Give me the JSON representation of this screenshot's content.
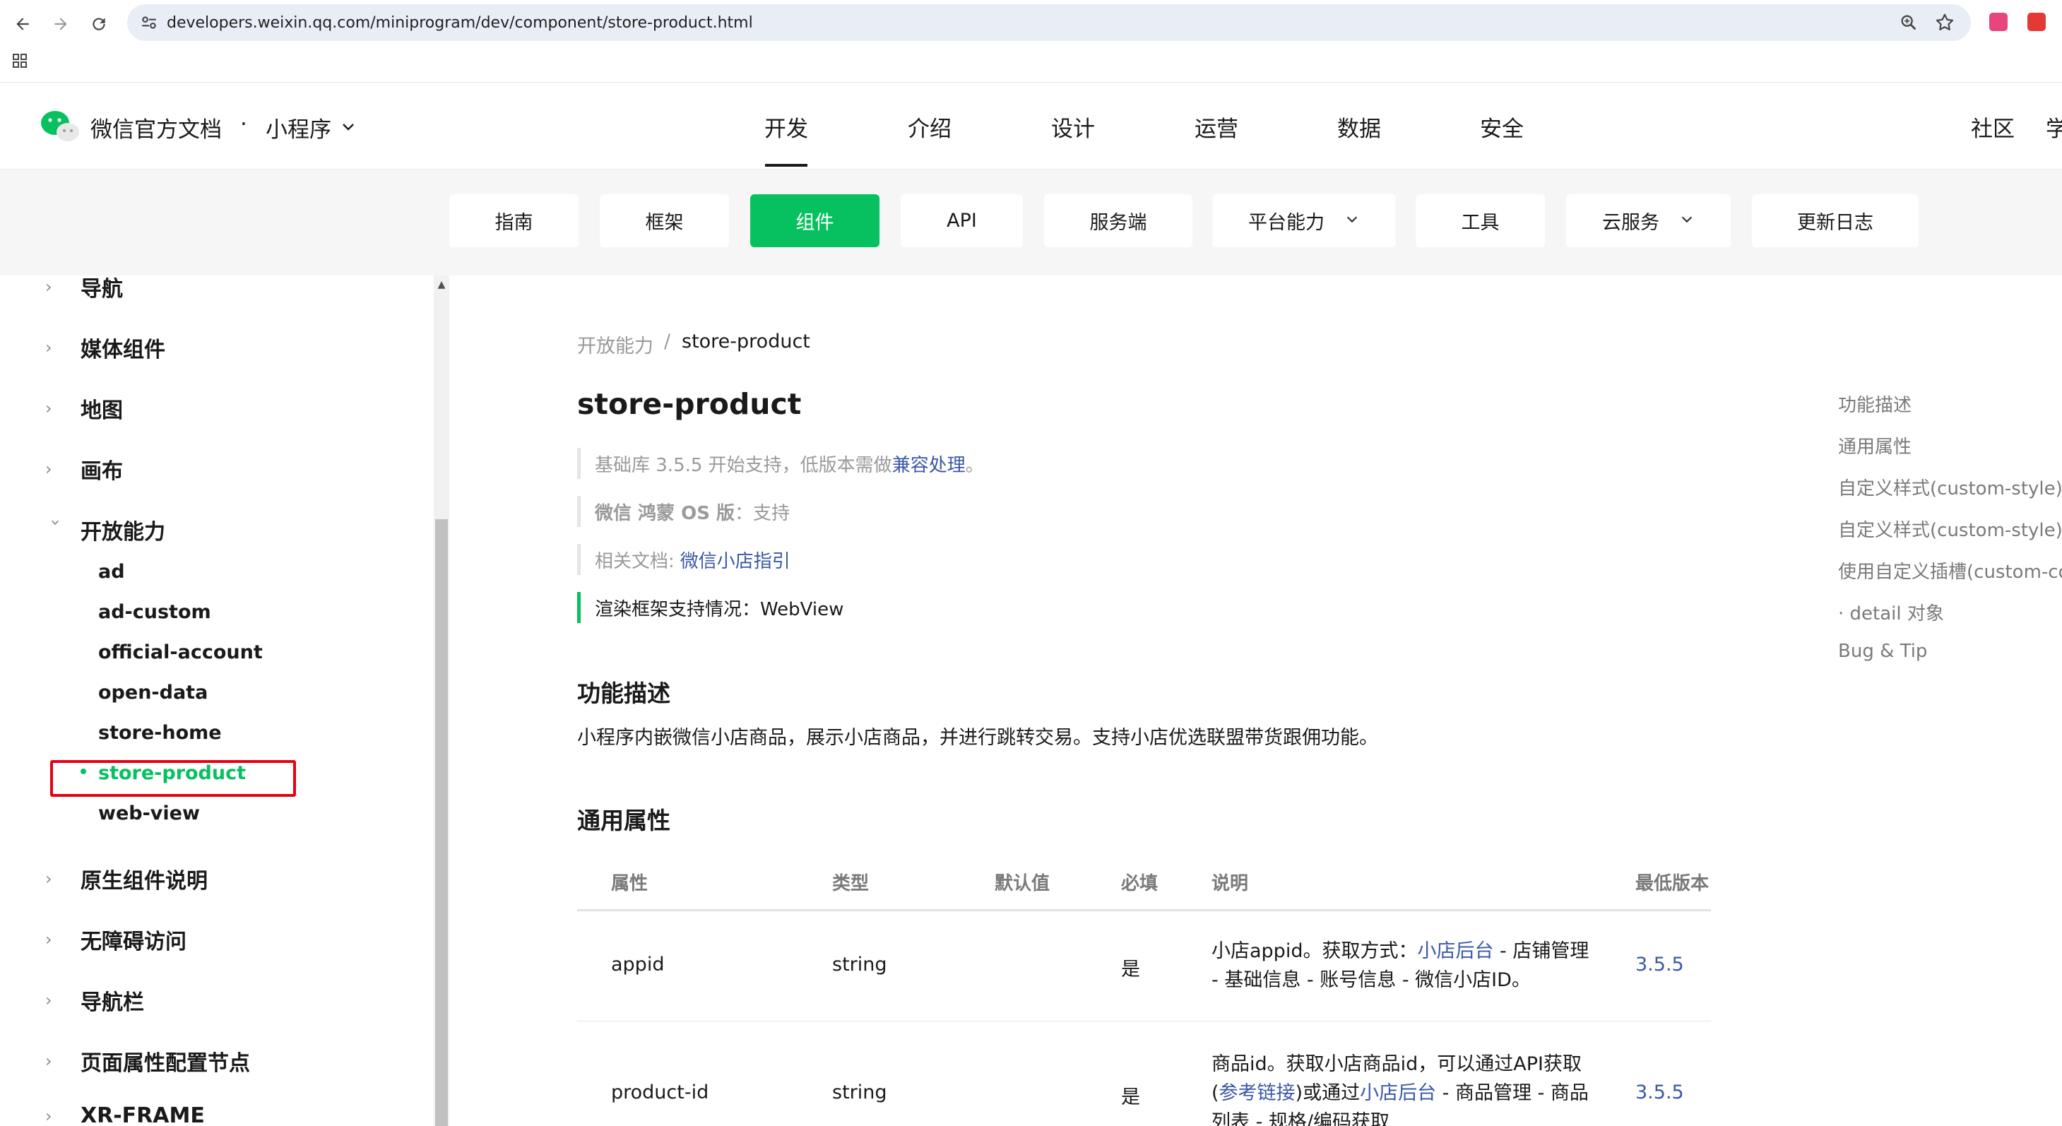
{
  "browser": {
    "url": "developers.weixin.qq.com/miniprogram/dev/component/store-product.html",
    "icons": [
      "back-icon",
      "forward-icon",
      "reload-icon",
      "site-settings-icon",
      "zoom-icon",
      "star-icon",
      "apps-icon"
    ]
  },
  "header": {
    "brand": "微信官方文档",
    "dot": "·",
    "product": "小程序",
    "nav": [
      "开发",
      "介绍",
      "设计",
      "运营",
      "数据",
      "安全"
    ],
    "community": "社区",
    "extra": "学"
  },
  "subtabs": [
    {
      "label": "指南"
    },
    {
      "label": "框架"
    },
    {
      "label": "组件"
    },
    {
      "label": "API"
    },
    {
      "label": "服务端"
    },
    {
      "label": "平台能力"
    },
    {
      "label": "工具"
    },
    {
      "label": "云服务"
    },
    {
      "label": "更新日志"
    }
  ],
  "sidebar": {
    "groups_top": [
      "导航",
      "媒体组件",
      "地图",
      "画布",
      "开放能力"
    ],
    "open_items": [
      "ad",
      "ad-custom",
      "official-account",
      "open-data",
      "store-home",
      "store-product",
      "web-view"
    ],
    "groups_bottom": [
      "原生组件说明",
      "无障碍访问",
      "导航栏",
      "页面属性配置节点",
      "XR-FRAME"
    ]
  },
  "breadcrumb": {
    "parent": "开放能力",
    "sep": "/",
    "current": "store-product"
  },
  "content": {
    "title": "store-product",
    "notes": {
      "base_prefix": "基础库 3.5.5 开始支持，低版本需做",
      "base_link": "兼容处理",
      "base_suffix": "。",
      "harmony_bold": "微信 鸿蒙 OS 版",
      "harmony_rest": "：支持",
      "docs_prefix": "相关文档: ",
      "docs_link": "微信小店指引",
      "render": "渲染框架支持情况：WebView"
    },
    "section1_title": "功能描述",
    "section1_text": "小程序内嵌微信小店商品，展示小店商品，并进行跳转交易。支持小店优选联盟带货跟佣功能。",
    "section2_title": "通用属性",
    "table": {
      "headers": [
        "属性",
        "类型",
        "默认值",
        "必填",
        "说明",
        "最低版本"
      ],
      "rows": [
        {
          "name": "appid",
          "type": "string",
          "required": "是",
          "desc_pre": "小店appid。获取方式：",
          "desc_link": "小店后台",
          "desc_post": " - 店铺管理 - 基础信息 - 账号信息 - 微信小店ID。",
          "version": "3.5.5"
        },
        {
          "name": "product-id",
          "type": "string",
          "required": "是",
          "desc_pre": "商品id。获取小店商品id，可以通过API获取(",
          "desc_link": "参考链接",
          "desc_mid": ")或通过",
          "desc_link2": "小店后台",
          "desc_post": " - 商品管理 - 商品列表 - 规格/编码获取",
          "version": "3.5.5"
        }
      ]
    }
  },
  "toc": [
    "功能描述",
    "通用属性",
    "自定义样式(custom-style)",
    "自定义样式(custom-style)示",
    "使用自定义插槽(custom-co",
    "· detail 对象",
    "Bug & Tip"
  ]
}
